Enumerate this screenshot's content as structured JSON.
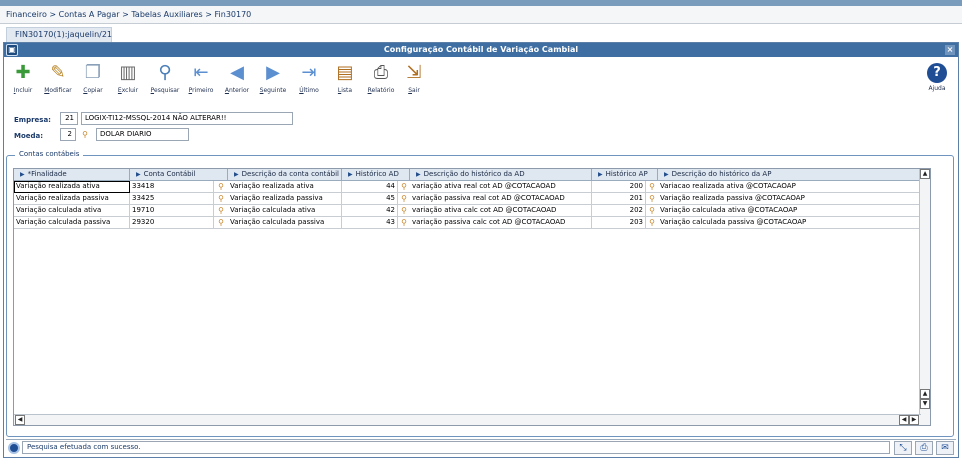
{
  "breadcrumb": "Financeiro > Contas A Pagar > Tabelas Auxiliares > Fin30170",
  "tab": "FIN30170(1):jaquelin/21",
  "window_title": "Configuração Contábil de Variação Cambial",
  "toolbar": [
    {
      "label": "Incluir",
      "icon": "add-document-icon",
      "glyph": "📄"
    },
    {
      "label": "Modificar",
      "icon": "edit-pencil-icon",
      "glyph": "✎"
    },
    {
      "label": "Copiar",
      "icon": "copy-icon",
      "glyph": "⎘"
    },
    {
      "label": "Excluir",
      "icon": "trash-icon",
      "glyph": "🗑"
    },
    {
      "label": "Pesquisar",
      "icon": "search-icon",
      "glyph": "🔍"
    },
    {
      "label": "Primeiro",
      "icon": "first-arrow-icon",
      "glyph": "⇤"
    },
    {
      "label": "Anterior",
      "icon": "previous-arrow-icon",
      "glyph": "◁"
    },
    {
      "label": "Seguinte",
      "icon": "next-arrow-icon",
      "glyph": "▷"
    },
    {
      "label": "Último",
      "icon": "last-arrow-icon",
      "glyph": "⇥"
    },
    {
      "label": "Lista",
      "icon": "book-list-icon",
      "glyph": "📖"
    },
    {
      "label": "Relatório",
      "icon": "printer-icon",
      "glyph": "🖶"
    },
    {
      "label": "Sair",
      "icon": "exit-door-icon",
      "glyph": "🚪"
    }
  ],
  "help_label": "Ajuda",
  "form": {
    "empresa_label": "Empresa:",
    "empresa_code": "21",
    "empresa_desc": "LOGIX-TI12-MSSQL-2014 NÃO ALTERAR!!",
    "moeda_label": "Moeda:",
    "moeda_code": "2",
    "moeda_desc": "DOLAR DIARIO"
  },
  "grid": {
    "title": "Contas contábeis",
    "columns": [
      "*Finalidade",
      "Conta Contábil",
      "Descrição da conta contábil",
      "Histórico AD",
      "Descrição do histórico da AD",
      "Histórico AP",
      "Descrição do histórico da AP"
    ],
    "rows": [
      [
        "Variação realizada ativa",
        "33418",
        "Variação realizada ativa",
        "44",
        "variação ativa real cot AD @COTACAOAD",
        "200",
        "Variacao realizada ativa @COTACAOAP"
      ],
      [
        "Variação realizada passiva",
        "33425",
        "Variação realizada passiva",
        "45",
        "variação passiva real cot AD @COTACAOAD",
        "201",
        "Variação realizada passiva @COTACAOAP"
      ],
      [
        "Variação calculada ativa",
        "19710",
        "Variação calculada ativa",
        "42",
        "variação ativa calc cot AD @COTACAOAD",
        "202",
        "Variação calculada ativa @COTACAOAP"
      ],
      [
        "Variação calculada passiva",
        "29320",
        "Variação calculada passiva",
        "43",
        "variação passiva calc cot AD @COTACAOAD",
        "203",
        "Variação calculada passiva @COTACAOAP"
      ]
    ]
  },
  "status_message": "Pesquisa efetuada com sucesso."
}
